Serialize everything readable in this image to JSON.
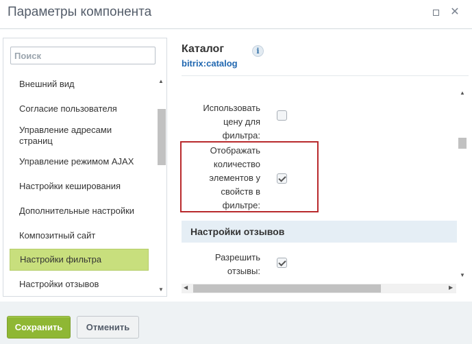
{
  "window": {
    "title": "Параметры компонента",
    "maximize_icon": "maximize-icon",
    "close_icon": "close-icon",
    "close_glyph": "✕"
  },
  "sidebar": {
    "search_placeholder": "Поиск",
    "items": [
      {
        "label": "Внешний вид",
        "active": false
      },
      {
        "label": "Согласие пользователя",
        "active": false
      },
      {
        "label": "Управление адресами страниц",
        "active": false
      },
      {
        "label": "Управление режимом AJAX",
        "active": false
      },
      {
        "label": "Настройки кеширования",
        "active": false
      },
      {
        "label": "Дополнительные настройки",
        "active": false
      },
      {
        "label": "Композитный сайт",
        "active": false
      },
      {
        "label": "Настройки фильтра",
        "active": true
      },
      {
        "label": "Настройки отзывов",
        "active": false
      }
    ],
    "active_color": "#c8df7d"
  },
  "component": {
    "name": "Каталог",
    "code": "bitrix:catalog",
    "info_icon": "info-icon",
    "info_glyph": "i"
  },
  "options": [
    {
      "label_lines": [
        "Использовать",
        "цену для фильтра:"
      ],
      "checked": false
    },
    {
      "label_lines": [
        "Отображать",
        "количество",
        "элементов у",
        "свойств в",
        "фильтре:"
      ],
      "checked": true,
      "highlighted": true
    },
    {
      "label_lines": [
        "Разрешить",
        "отзывы:"
      ],
      "checked": true
    }
  ],
  "sections": {
    "reviews_header": "Настройки отзывов"
  },
  "footer": {
    "save_label": "Сохранить",
    "cancel_label": "Отменить"
  },
  "colors": {
    "save_button": "#8fb734",
    "highlight_border": "#b8282b",
    "link": "#2067b0"
  }
}
